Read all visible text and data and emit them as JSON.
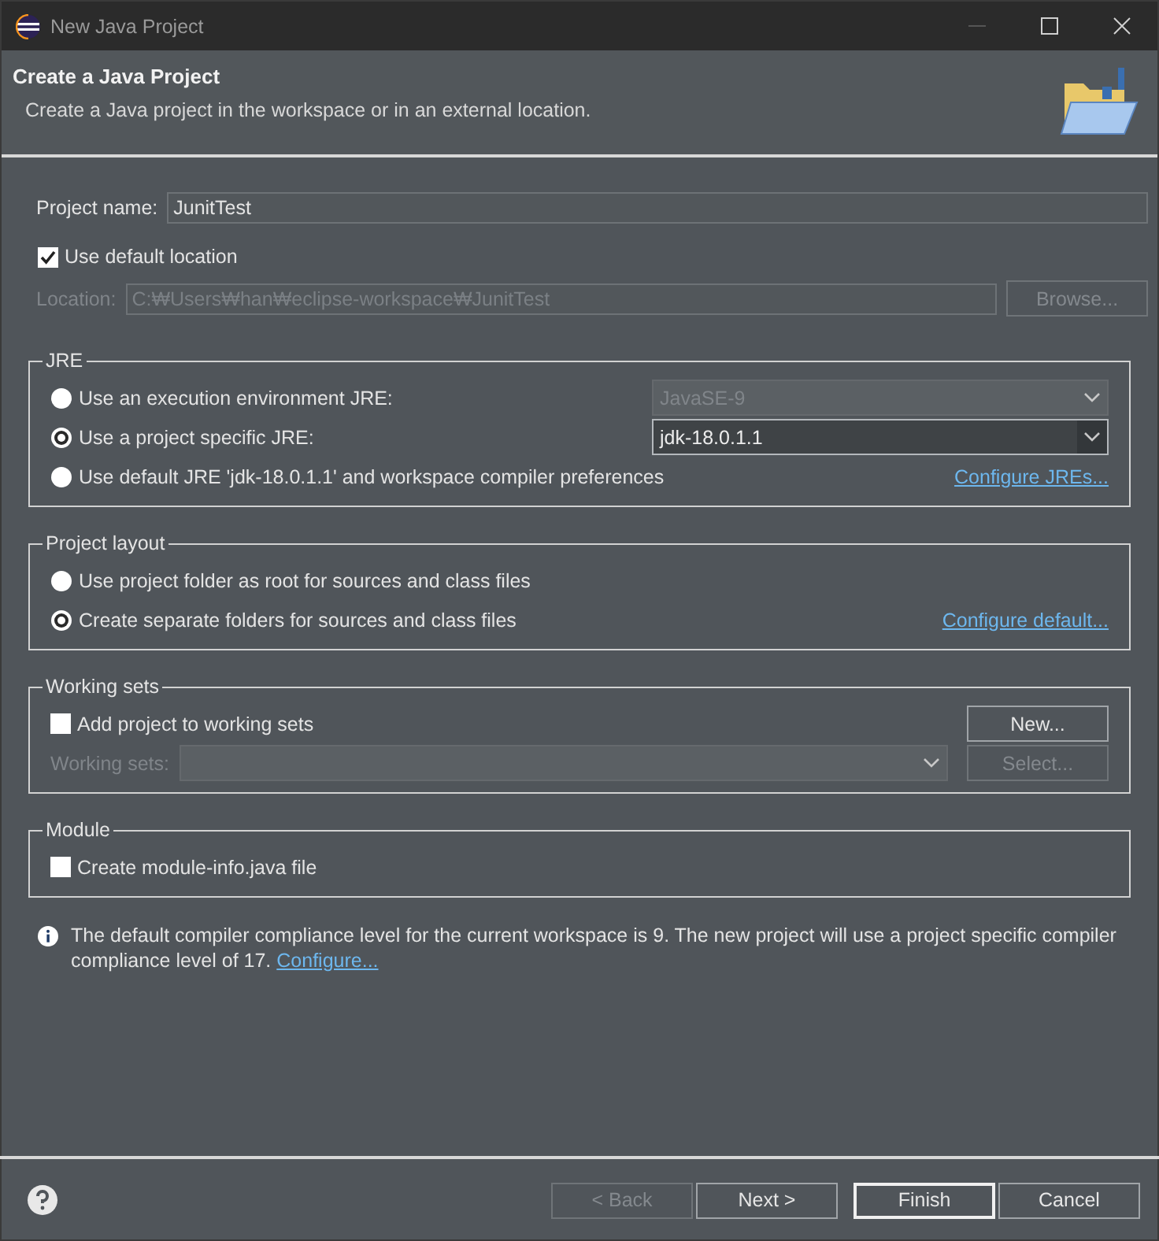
{
  "window": {
    "title": "New Java Project"
  },
  "header": {
    "title": "Create a Java Project",
    "description": "Create a Java project in the workspace or in an external location."
  },
  "project_name": {
    "label": "Project name:",
    "value": "JunitTest"
  },
  "use_default_location": {
    "label": "Use default location",
    "checked": true
  },
  "location": {
    "label": "Location:",
    "value": "C:₩Users₩han₩eclipse-workspace₩JunitTest",
    "disabled": true,
    "button": {
      "label": "Browse...",
      "disabled": true
    }
  },
  "groups": [
    {
      "title": "JRE",
      "rows": [
        {
          "kind": "radio",
          "label": "Use an execution environment JRE:",
          "selected": false,
          "right": {
            "kind": "combo",
            "value": "JavaSE-9",
            "disabled": true
          }
        },
        {
          "kind": "radio",
          "label": "Use a project specific JRE:",
          "selected": true,
          "right": {
            "kind": "combo",
            "value": "jdk-18.0.1.1",
            "disabled": false
          }
        },
        {
          "kind": "radio",
          "label": "Use default JRE 'jdk-18.0.1.1' and workspace compiler preferences",
          "selected": false,
          "right": {
            "kind": "link",
            "label": "Configure JREs..."
          }
        }
      ]
    },
    {
      "title": "Project layout",
      "rows": [
        {
          "kind": "radio",
          "label": "Use project folder as root for sources and class files",
          "selected": false
        },
        {
          "kind": "radio",
          "label": "Create separate folders for sources and class files",
          "selected": true,
          "right": {
            "kind": "link",
            "label": "Configure default..."
          }
        }
      ]
    },
    {
      "title": "Working sets",
      "rows": [
        {
          "kind": "check",
          "label": "Add project to working sets",
          "checked": false,
          "right": {
            "kind": "button",
            "label": "New...",
            "disabled": false
          }
        },
        {
          "kind": "combo",
          "label": "Working sets:",
          "disabled": true,
          "right": {
            "kind": "button",
            "label": "Select...",
            "disabled": true
          }
        }
      ]
    },
    {
      "title": "Module",
      "rows": [
        {
          "kind": "check",
          "label": "Create module-info.java file",
          "checked": false
        }
      ]
    }
  ],
  "info": {
    "text": "The default compiler compliance level for the current workspace is 9. The new project will use a project specific compiler compliance level of 17.",
    "link": "Configure..."
  },
  "buttons": [
    {
      "label": "< Back",
      "disabled": true,
      "default": false
    },
    {
      "label": "Next >",
      "disabled": false,
      "default": false
    },
    {
      "label": "Finish",
      "disabled": false,
      "default": true
    },
    {
      "label": "Cancel",
      "disabled": false,
      "default": false
    }
  ]
}
